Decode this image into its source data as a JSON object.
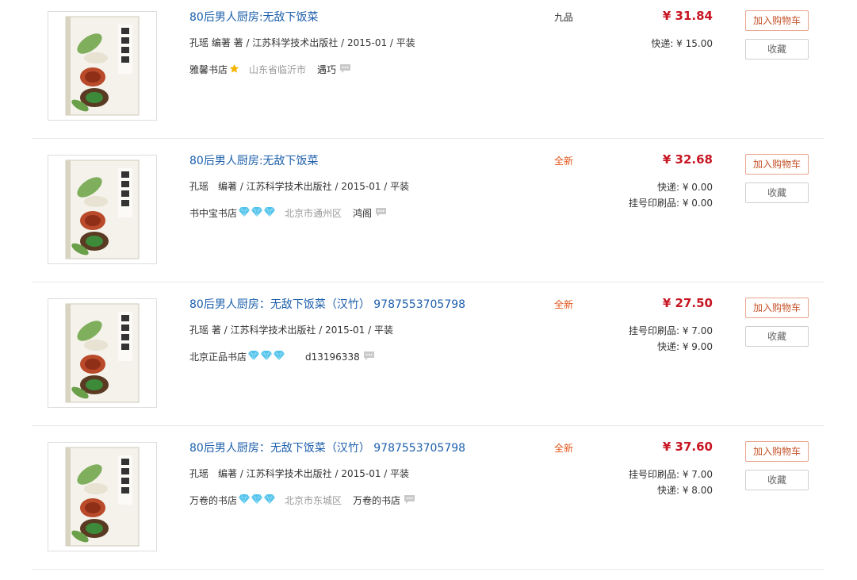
{
  "listings": [
    {
      "title": "80后男人厨房:无敌下饭菜",
      "meta": "孔瑶 编著 著 / 江苏科学技术出版社 / 2015-01 / 平装",
      "shop": "雅馨书店",
      "badge": "star",
      "location": "山东省临沂市",
      "seller": "遇巧",
      "condition": "九品",
      "price": "¥ 31.84",
      "shipping": [
        "快递: ¥ 15.00"
      ],
      "cart_label": "加入购物车",
      "fav_label": "收藏"
    },
    {
      "title": "80后男人厨房:无敌下饭菜",
      "meta": "孔瑶　编著 / 江苏科学技术出版社 / 2015-01 / 平装",
      "shop": "书中宝书店",
      "badge": "diamond",
      "location": "北京市通州区",
      "seller": "鸿阁",
      "condition": "全新",
      "price": "¥ 32.68",
      "shipping": [
        "快递: ¥ 0.00",
        "挂号印刷品: ¥ 0.00"
      ],
      "cart_label": "加入购物车",
      "fav_label": "收藏"
    },
    {
      "title": "80后男人厨房：无敌下饭菜（汉竹） 9787553705798",
      "meta": "孔瑶 著 / 江苏科学技术出版社 / 2015-01 / 平装",
      "shop": "北京正品书店",
      "badge": "diamond",
      "location": "",
      "seller": "d13196338",
      "condition": "全新",
      "price": "¥ 27.50",
      "shipping": [
        "挂号印刷品: ¥ 7.00",
        "快递: ¥ 9.00"
      ],
      "cart_label": "加入购物车",
      "fav_label": "收藏"
    },
    {
      "title": "80后男人厨房：无敌下饭菜（汉竹） 9787553705798",
      "meta": "孔瑶　编著 / 江苏科学技术出版社 / 2015-01 / 平装",
      "shop": "万卷的书店",
      "badge": "diamond",
      "location": "北京市东城区",
      "seller": "万卷的书店",
      "condition": "全新",
      "price": "¥ 37.60",
      "shipping": [
        "挂号印刷品: ¥ 7.00",
        "快递: ¥ 8.00"
      ],
      "cart_label": "加入购物车",
      "fav_label": "收藏"
    }
  ],
  "colors": {
    "title": "#1c5fab",
    "price": "#c81623",
    "new": "#e2561a",
    "cart_border": "#e8a58c"
  }
}
